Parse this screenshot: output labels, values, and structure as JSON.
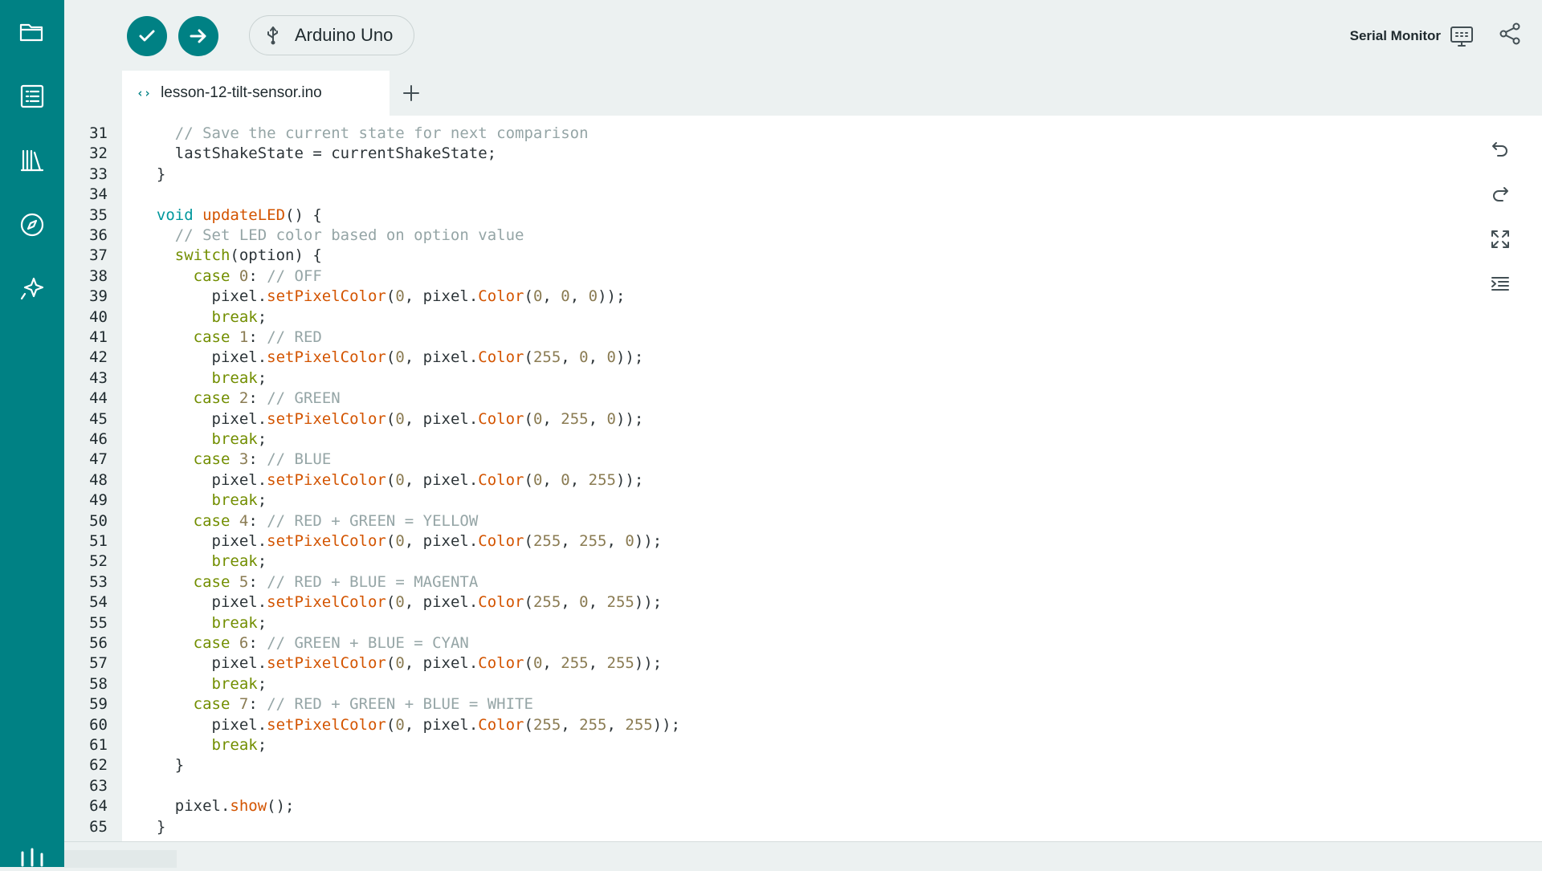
{
  "sidebar": {
    "items": [
      {
        "icon": "folder-icon"
      },
      {
        "icon": "sketch-list-icon"
      },
      {
        "icon": "library-icon"
      },
      {
        "icon": "compass-icon"
      },
      {
        "icon": "sparkle-icon"
      }
    ],
    "bottom_icon": "sliders-icon"
  },
  "toolbar": {
    "verify_icon": "checkmark-icon",
    "upload_icon": "arrow-right-icon",
    "board_label": "Arduino Uno",
    "board_icon": "usb-icon",
    "serial_monitor_label": "Serial Monitor",
    "serial_monitor_icon": "monitor-icon",
    "share_icon": "share-icon"
  },
  "tabs": [
    {
      "label": "lesson-12-tilt-sensor.ino",
      "icon": "code-icon"
    }
  ],
  "add_tab_icon": "plus-icon",
  "editor_tools": [
    "undo-icon",
    "redo-icon",
    "expand-icon",
    "indent-icon"
  ],
  "code": {
    "first_line": 31,
    "lines": [
      [
        [
          "    ",
          "plain"
        ],
        [
          "// Save the current state for next comparison",
          "comment"
        ]
      ],
      [
        [
          "    lastShakeState = currentShakeState;",
          "plain"
        ]
      ],
      [
        [
          "  }",
          "plain"
        ]
      ],
      [
        [
          "",
          "plain"
        ]
      ],
      [
        [
          "  ",
          "plain"
        ],
        [
          "void",
          "keyword"
        ],
        [
          " ",
          "plain"
        ],
        [
          "updateLED",
          "function"
        ],
        [
          "() {",
          "plain"
        ]
      ],
      [
        [
          "    ",
          "plain"
        ],
        [
          "// Set LED color based on option value",
          "comment"
        ]
      ],
      [
        [
          "    ",
          "plain"
        ],
        [
          "switch",
          "control"
        ],
        [
          "(option) {",
          "plain"
        ]
      ],
      [
        [
          "      ",
          "plain"
        ],
        [
          "case",
          "control"
        ],
        [
          " ",
          "plain"
        ],
        [
          "0",
          "number"
        ],
        [
          ": ",
          "plain"
        ],
        [
          "// OFF",
          "comment"
        ]
      ],
      [
        [
          "        pixel.",
          "plain"
        ],
        [
          "setPixelColor",
          "function"
        ],
        [
          "(",
          "plain"
        ],
        [
          "0",
          "number"
        ],
        [
          ", pixel.",
          "plain"
        ],
        [
          "Color",
          "function"
        ],
        [
          "(",
          "plain"
        ],
        [
          "0",
          "number"
        ],
        [
          ", ",
          "plain"
        ],
        [
          "0",
          "number"
        ],
        [
          ", ",
          "plain"
        ],
        [
          "0",
          "number"
        ],
        [
          "));",
          "plain"
        ]
      ],
      [
        [
          "        ",
          "plain"
        ],
        [
          "break",
          "control"
        ],
        [
          ";",
          "plain"
        ]
      ],
      [
        [
          "      ",
          "plain"
        ],
        [
          "case",
          "control"
        ],
        [
          " ",
          "plain"
        ],
        [
          "1",
          "number"
        ],
        [
          ": ",
          "plain"
        ],
        [
          "// RED",
          "comment"
        ]
      ],
      [
        [
          "        pixel.",
          "plain"
        ],
        [
          "setPixelColor",
          "function"
        ],
        [
          "(",
          "plain"
        ],
        [
          "0",
          "number"
        ],
        [
          ", pixel.",
          "plain"
        ],
        [
          "Color",
          "function"
        ],
        [
          "(",
          "plain"
        ],
        [
          "255",
          "number"
        ],
        [
          ", ",
          "plain"
        ],
        [
          "0",
          "number"
        ],
        [
          ", ",
          "plain"
        ],
        [
          "0",
          "number"
        ],
        [
          "));",
          "plain"
        ]
      ],
      [
        [
          "        ",
          "plain"
        ],
        [
          "break",
          "control"
        ],
        [
          ";",
          "plain"
        ]
      ],
      [
        [
          "      ",
          "plain"
        ],
        [
          "case",
          "control"
        ],
        [
          " ",
          "plain"
        ],
        [
          "2",
          "number"
        ],
        [
          ": ",
          "plain"
        ],
        [
          "// GREEN",
          "comment"
        ]
      ],
      [
        [
          "        pixel.",
          "plain"
        ],
        [
          "setPixelColor",
          "function"
        ],
        [
          "(",
          "plain"
        ],
        [
          "0",
          "number"
        ],
        [
          ", pixel.",
          "plain"
        ],
        [
          "Color",
          "function"
        ],
        [
          "(",
          "plain"
        ],
        [
          "0",
          "number"
        ],
        [
          ", ",
          "plain"
        ],
        [
          "255",
          "number"
        ],
        [
          ", ",
          "plain"
        ],
        [
          "0",
          "number"
        ],
        [
          "));",
          "plain"
        ]
      ],
      [
        [
          "        ",
          "plain"
        ],
        [
          "break",
          "control"
        ],
        [
          ";",
          "plain"
        ]
      ],
      [
        [
          "      ",
          "plain"
        ],
        [
          "case",
          "control"
        ],
        [
          " ",
          "plain"
        ],
        [
          "3",
          "number"
        ],
        [
          ": ",
          "plain"
        ],
        [
          "// BLUE",
          "comment"
        ]
      ],
      [
        [
          "        pixel.",
          "plain"
        ],
        [
          "setPixelColor",
          "function"
        ],
        [
          "(",
          "plain"
        ],
        [
          "0",
          "number"
        ],
        [
          ", pixel.",
          "plain"
        ],
        [
          "Color",
          "function"
        ],
        [
          "(",
          "plain"
        ],
        [
          "0",
          "number"
        ],
        [
          ", ",
          "plain"
        ],
        [
          "0",
          "number"
        ],
        [
          ", ",
          "plain"
        ],
        [
          "255",
          "number"
        ],
        [
          "));",
          "plain"
        ]
      ],
      [
        [
          "        ",
          "plain"
        ],
        [
          "break",
          "control"
        ],
        [
          ";",
          "plain"
        ]
      ],
      [
        [
          "      ",
          "plain"
        ],
        [
          "case",
          "control"
        ],
        [
          " ",
          "plain"
        ],
        [
          "4",
          "number"
        ],
        [
          ": ",
          "plain"
        ],
        [
          "// RED + GREEN = YELLOW",
          "comment"
        ]
      ],
      [
        [
          "        pixel.",
          "plain"
        ],
        [
          "setPixelColor",
          "function"
        ],
        [
          "(",
          "plain"
        ],
        [
          "0",
          "number"
        ],
        [
          ", pixel.",
          "plain"
        ],
        [
          "Color",
          "function"
        ],
        [
          "(",
          "plain"
        ],
        [
          "255",
          "number"
        ],
        [
          ", ",
          "plain"
        ],
        [
          "255",
          "number"
        ],
        [
          ", ",
          "plain"
        ],
        [
          "0",
          "number"
        ],
        [
          "));",
          "plain"
        ]
      ],
      [
        [
          "        ",
          "plain"
        ],
        [
          "break",
          "control"
        ],
        [
          ";",
          "plain"
        ]
      ],
      [
        [
          "      ",
          "plain"
        ],
        [
          "case",
          "control"
        ],
        [
          " ",
          "plain"
        ],
        [
          "5",
          "number"
        ],
        [
          ": ",
          "plain"
        ],
        [
          "// RED + BLUE = MAGENTA",
          "comment"
        ]
      ],
      [
        [
          "        pixel.",
          "plain"
        ],
        [
          "setPixelColor",
          "function"
        ],
        [
          "(",
          "plain"
        ],
        [
          "0",
          "number"
        ],
        [
          ", pixel.",
          "plain"
        ],
        [
          "Color",
          "function"
        ],
        [
          "(",
          "plain"
        ],
        [
          "255",
          "number"
        ],
        [
          ", ",
          "plain"
        ],
        [
          "0",
          "number"
        ],
        [
          ", ",
          "plain"
        ],
        [
          "255",
          "number"
        ],
        [
          "));",
          "plain"
        ]
      ],
      [
        [
          "        ",
          "plain"
        ],
        [
          "break",
          "control"
        ],
        [
          ";",
          "plain"
        ]
      ],
      [
        [
          "      ",
          "plain"
        ],
        [
          "case",
          "control"
        ],
        [
          " ",
          "plain"
        ],
        [
          "6",
          "number"
        ],
        [
          ": ",
          "plain"
        ],
        [
          "// GREEN + BLUE = CYAN",
          "comment"
        ]
      ],
      [
        [
          "        pixel.",
          "plain"
        ],
        [
          "setPixelColor",
          "function"
        ],
        [
          "(",
          "plain"
        ],
        [
          "0",
          "number"
        ],
        [
          ", pixel.",
          "plain"
        ],
        [
          "Color",
          "function"
        ],
        [
          "(",
          "plain"
        ],
        [
          "0",
          "number"
        ],
        [
          ", ",
          "plain"
        ],
        [
          "255",
          "number"
        ],
        [
          ", ",
          "plain"
        ],
        [
          "255",
          "number"
        ],
        [
          "));",
          "plain"
        ]
      ],
      [
        [
          "        ",
          "plain"
        ],
        [
          "break",
          "control"
        ],
        [
          ";",
          "plain"
        ]
      ],
      [
        [
          "      ",
          "plain"
        ],
        [
          "case",
          "control"
        ],
        [
          " ",
          "plain"
        ],
        [
          "7",
          "number"
        ],
        [
          ": ",
          "plain"
        ],
        [
          "// RED + GREEN + BLUE = WHITE",
          "comment"
        ]
      ],
      [
        [
          "        pixel.",
          "plain"
        ],
        [
          "setPixelColor",
          "function"
        ],
        [
          "(",
          "plain"
        ],
        [
          "0",
          "number"
        ],
        [
          ", pixel.",
          "plain"
        ],
        [
          "Color",
          "function"
        ],
        [
          "(",
          "plain"
        ],
        [
          "255",
          "number"
        ],
        [
          ", ",
          "plain"
        ],
        [
          "255",
          "number"
        ],
        [
          ", ",
          "plain"
        ],
        [
          "255",
          "number"
        ],
        [
          "));",
          "plain"
        ]
      ],
      [
        [
          "        ",
          "plain"
        ],
        [
          "break",
          "control"
        ],
        [
          ";",
          "plain"
        ]
      ],
      [
        [
          "    }",
          "plain"
        ]
      ],
      [
        [
          "",
          "plain"
        ]
      ],
      [
        [
          "    pixel.",
          "plain"
        ],
        [
          "show",
          "function"
        ],
        [
          "();",
          "plain"
        ]
      ],
      [
        [
          "  }",
          "plain"
        ]
      ]
    ]
  },
  "colors": {
    "accent": "#008184",
    "comment": "#95a5a6",
    "keyword": "#00979c",
    "control": "#728e00",
    "function": "#d35400",
    "number": "#8a7b52"
  }
}
